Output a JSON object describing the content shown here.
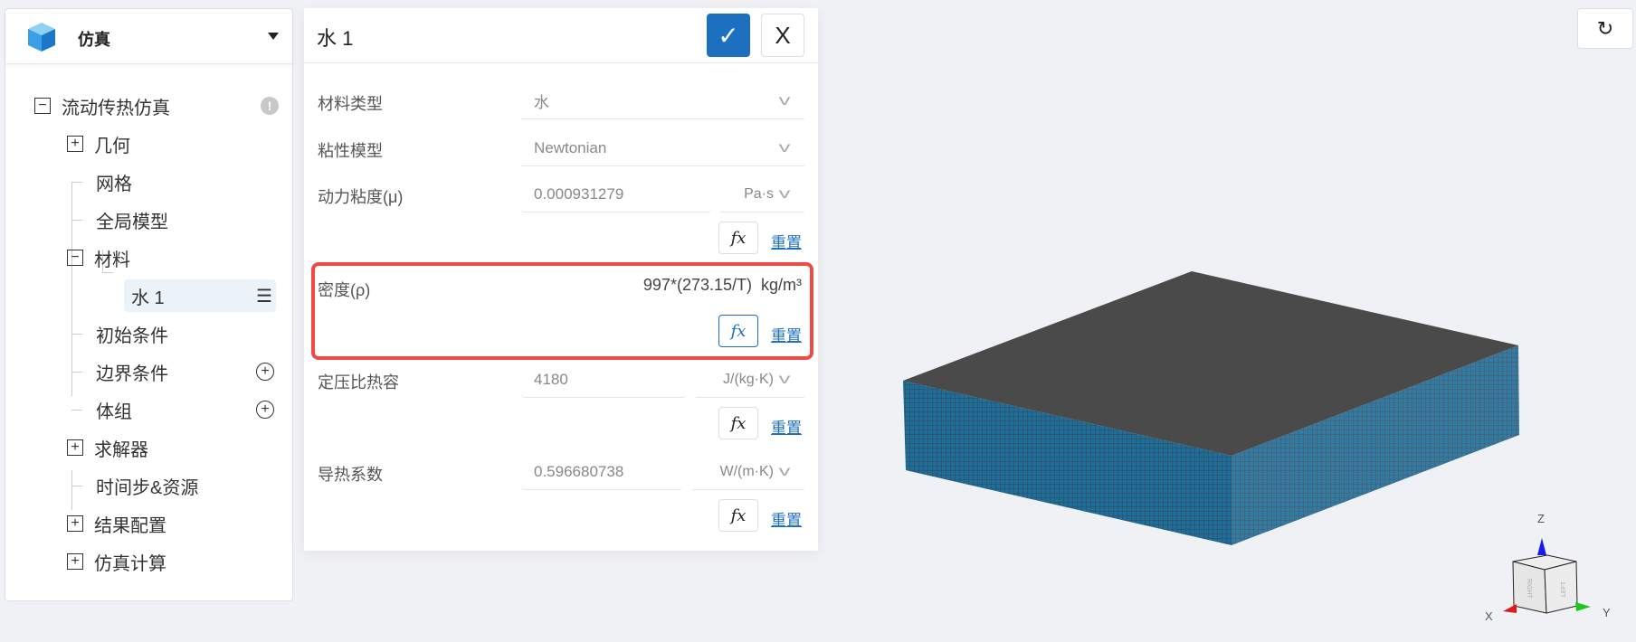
{
  "app": {
    "title": "仿真",
    "logo_icon": "cube-logo"
  },
  "tree": {
    "root": "流动传热仿真",
    "items": [
      "几何",
      "网格",
      "全局模型",
      "材料",
      "水 1",
      "初始条件",
      "边界条件",
      "体组",
      "求解器",
      "时间步&资源",
      "结果配置",
      "仿真计算"
    ]
  },
  "form": {
    "title": "水 1",
    "confirm_icon": "check-icon",
    "close_label": "X",
    "fields": [
      {
        "label": "材料类型",
        "value": "水"
      },
      {
        "label": "粘性模型",
        "value": "Newtonian"
      },
      {
        "label": "动力粘度(μ)",
        "value": "0.000931279",
        "unit": "Pa·s"
      },
      {
        "label": "密度(ρ)",
        "value": "997*(273.15/T)",
        "unit": "kg/m³"
      },
      {
        "label": "定压比热容",
        "value": "4180",
        "unit": "J/(kg·K)"
      },
      {
        "label": "导热系数",
        "value": "0.596680738",
        "unit": "W/(m·K)"
      }
    ],
    "fx_label": "fx",
    "reset_label": "重置",
    "highlight_color": "#f04a47"
  },
  "viewport": {
    "mesh_colors": {
      "top": "#4a4a4a",
      "side": "#1b6f9e"
    },
    "axes": {
      "x": "X",
      "y": "Y",
      "z": "Z",
      "face_right": "RIGHT",
      "face_left": "LEFT"
    }
  },
  "accent": "#1d6fc0"
}
